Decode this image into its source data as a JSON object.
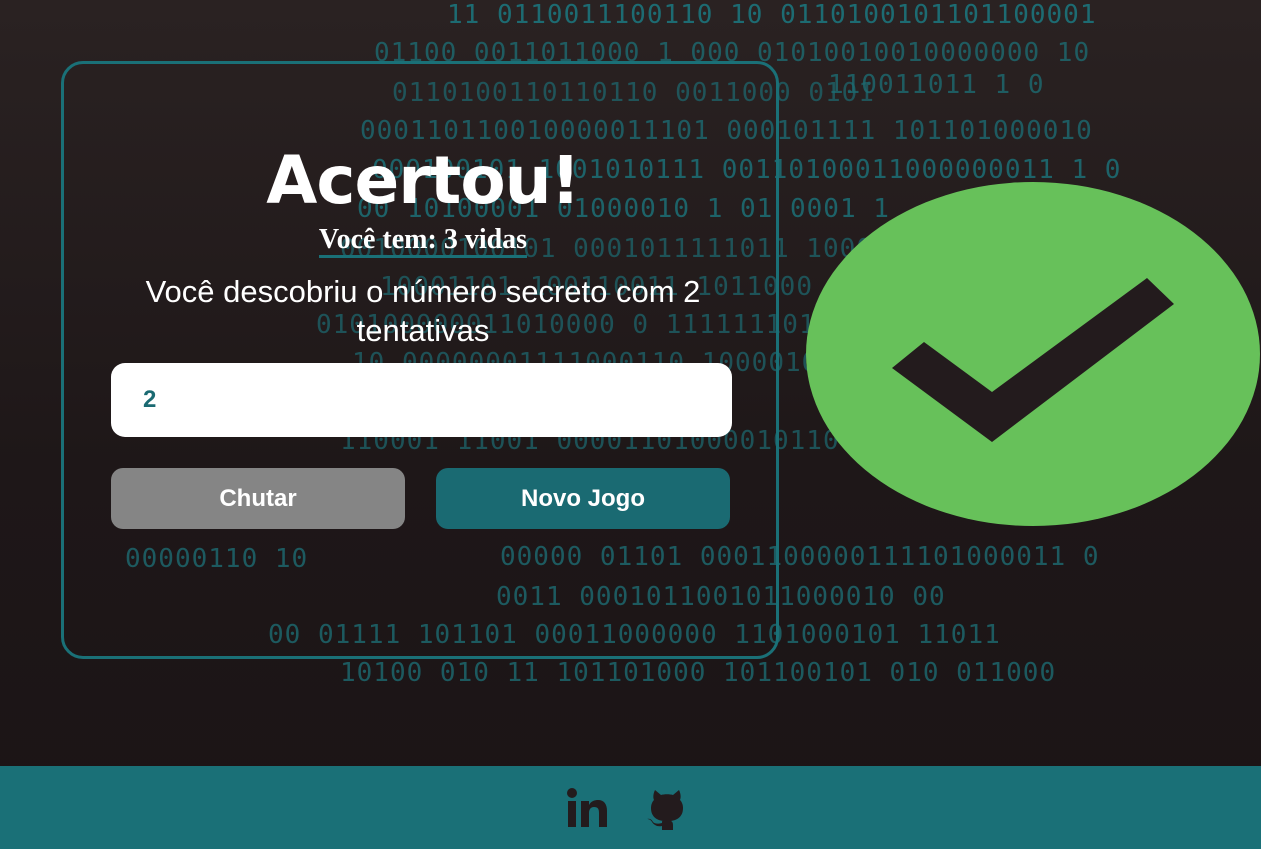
{
  "game": {
    "title": "Acertou!",
    "lives_text": "Você tem: 3 vidas",
    "message": "Você descobriu o número secreto com 2 tentativas",
    "input_value": "2",
    "guess_button": "Chutar",
    "new_game_button": "Novo Jogo"
  },
  "result_image": {
    "icon": "check-mark-icon",
    "circle_color": "#67c15a",
    "mark_color": "#231b1d"
  },
  "footer": {
    "icons": [
      "linkedin-icon",
      "github-icon"
    ],
    "background": "#1a7077"
  },
  "theme": {
    "accent": "#1a7077",
    "background": "#211a1b"
  },
  "background_digits": [
    "11 0110011100110 10 0110100101101100001",
    "01100 0011011000 1  000 01010010010000000 10",
    "110011011 1 0",
    "0110100110110110  0011000 0101",
    "000110110010000011101 000101111  101101000010",
    "000100101 1001010111 00110100011000000011 1 0",
    "00 10100001 01000010 1 01 0001 1",
    "0010000100101 0001011111011 1000",
    "10001101 100110011 1011000 011 0100 011",
    "010100000011010000 0  1111111010",
    "10 00000001111000110 1000010111101",
    "110001 11001 00001101000010110 001101101010",
    "00000110 10",
    "00000 01101 0001100000111101000011 0",
    "0011 0001011001011000010 00",
    "00 01111  101101 00011000000 1101000101 11011",
    "10100 010 11 101101000 101100101 010 011000"
  ]
}
